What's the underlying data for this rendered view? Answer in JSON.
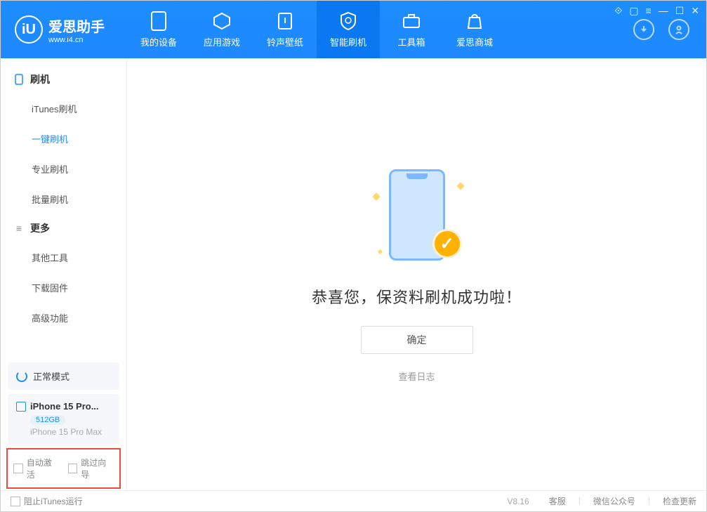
{
  "brand": {
    "name": "爱思助手",
    "url": "www.i4.cn",
    "logo_letter": "iU"
  },
  "window_controls": {
    "t1": "⟐",
    "t2": "▢",
    "t3": "≡",
    "t4": "—",
    "t5": "☐",
    "t6": "✕"
  },
  "nav": [
    {
      "label": "我的设备"
    },
    {
      "label": "应用游戏"
    },
    {
      "label": "铃声壁纸"
    },
    {
      "label": "智能刷机"
    },
    {
      "label": "工具箱"
    },
    {
      "label": "爱思商城"
    }
  ],
  "sidebar": {
    "group1": {
      "title": "刷机",
      "items": [
        "iTunes刷机",
        "一键刷机",
        "专业刷机",
        "批量刷机"
      ]
    },
    "group2": {
      "title": "更多",
      "items": [
        "其他工具",
        "下载固件",
        "高级功能"
      ]
    }
  },
  "status": {
    "mode": "正常模式"
  },
  "device": {
    "name": "iPhone 15 Pro...",
    "storage": "512GB",
    "model": "iPhone 15 Pro Max"
  },
  "annotated_checks": {
    "auto_activate": "自动激活",
    "skip_wizard": "跳过向导"
  },
  "main": {
    "success_title": "恭喜您，保资料刷机成功啦！",
    "ok_button": "确定",
    "view_log": "查看日志"
  },
  "footer": {
    "block_itunes": "阻止iTunes运行",
    "version": "V8.16",
    "links": [
      "客服",
      "微信公众号",
      "检查更新"
    ]
  }
}
